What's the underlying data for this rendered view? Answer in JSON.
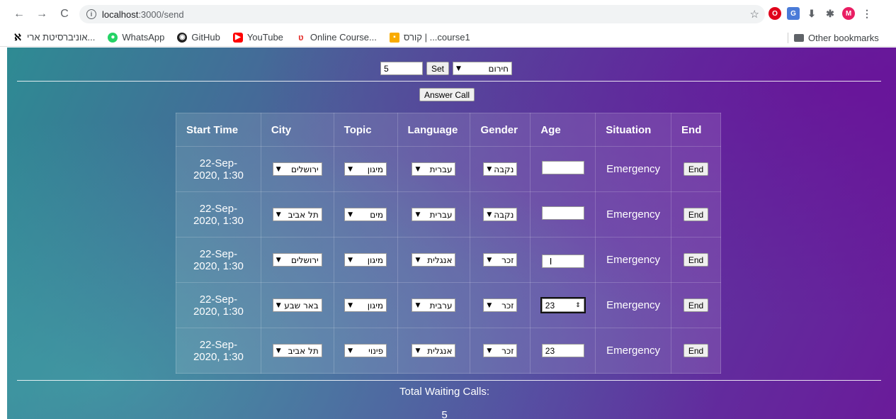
{
  "browser": {
    "url_host": "localhost",
    "url_path": ":3000/send",
    "profile_initial": "M",
    "bookmarks": [
      {
        "label": "אוניברסיטת ארי...",
        "icon": "university-icon"
      },
      {
        "label": "WhatsApp",
        "icon": "whatsapp-icon"
      },
      {
        "label": "GitHub",
        "icon": "github-icon"
      },
      {
        "label": "YouTube",
        "icon": "youtube-icon"
      },
      {
        "label": "Online Course...",
        "icon": "course-icon"
      },
      {
        "label": "קורס | ...course1",
        "icon": "classroom-icon"
      }
    ],
    "other_bookmarks": "Other bookmarks"
  },
  "controls": {
    "number_value": "5",
    "set_label": "Set",
    "mode_select": "חירום",
    "answer_label": "Answer Call"
  },
  "table": {
    "headers": [
      "Start Time",
      "City",
      "Topic",
      "Language",
      "Gender",
      "Age",
      "Situation",
      "End"
    ],
    "rows": [
      {
        "time": "22-Sep-2020, 1:30",
        "city": "ירושלים",
        "topic": "מיגון",
        "language": "עברית",
        "gender": "נקבה",
        "age": "",
        "situation": "Emergency",
        "end": "End"
      },
      {
        "time": "22-Sep-2020, 1:30",
        "city": "תל אביב",
        "topic": "מים",
        "language": "עברית",
        "gender": "נקבה",
        "age": "",
        "situation": "Emergency",
        "end": "End"
      },
      {
        "time": "22-Sep-2020, 1:30",
        "city": "ירושלים",
        "topic": "מיגון",
        "language": "אנגלית",
        "gender": "זכר",
        "age": "",
        "situation": "Emergency",
        "end": "End"
      },
      {
        "time": "22-Sep-2020, 1:30",
        "city": "באר שבע",
        "topic": "מיגון",
        "language": "ערבית",
        "gender": "זכר",
        "age": "23",
        "situation": "Emergency",
        "end": "End"
      },
      {
        "time": "22-Sep-2020, 1:30",
        "city": "תל אביב",
        "topic": "פינוי",
        "language": "אנגלית",
        "gender": "זכר",
        "age": "23",
        "situation": "Emergency",
        "end": "End"
      }
    ]
  },
  "footer": {
    "label": "Total Waiting Calls:",
    "count": "5"
  },
  "colors": {
    "gradient_start": "#2e8b93",
    "gradient_end": "#6a1b9a"
  }
}
